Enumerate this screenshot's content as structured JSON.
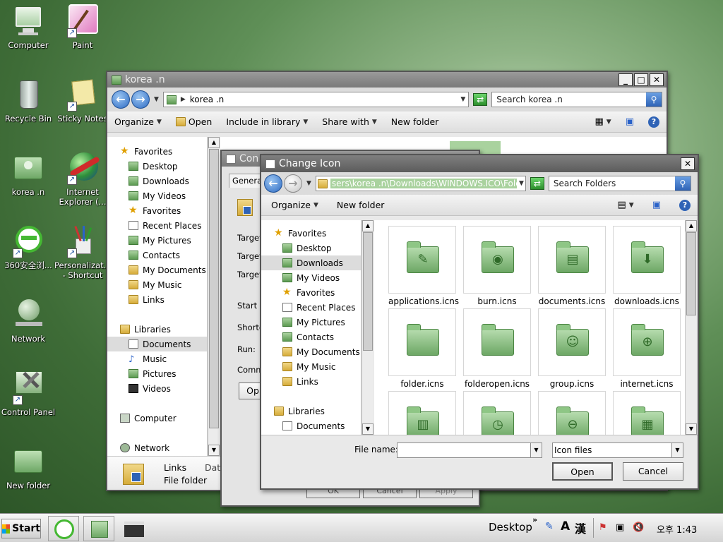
{
  "desktop": {
    "icons": [
      {
        "label": "Computer",
        "icon": "computer-icon"
      },
      {
        "label": "Paint",
        "icon": "paint-icon"
      },
      {
        "label": "Recycle Bin",
        "icon": "recycle-bin-icon"
      },
      {
        "label": "Sticky Notes",
        "icon": "sticky-notes-icon"
      },
      {
        "label": "korea .n",
        "icon": "user-folder-icon"
      },
      {
        "label": "Internet Explorer (...",
        "icon": "internet-explorer-icon"
      },
      {
        "label": "360安全浏...",
        "icon": "security-360-icon"
      },
      {
        "label": "Personalizat... - Shortcut",
        "icon": "personalization-icon"
      },
      {
        "label": "Network",
        "icon": "network-icon"
      },
      {
        "label": "Control Panel",
        "icon": "control-panel-icon"
      },
      {
        "label": "New folder",
        "icon": "folder-icon"
      }
    ]
  },
  "explorer": {
    "title": "korea .n",
    "address": "korea .n",
    "search_placeholder": "Search korea .n",
    "toolbar": {
      "organize": "Organize",
      "open": "Open",
      "include": "Include in library",
      "share": "Share with",
      "newfolder": "New folder"
    },
    "nav": {
      "favorites_head": "Favorites",
      "favorites": [
        "Desktop",
        "Downloads",
        "My Videos",
        "Favorites",
        "Recent Places",
        "My Pictures",
        "Contacts",
        "My Documents",
        "My Music",
        "Links"
      ],
      "libraries_head": "Libraries",
      "libraries": [
        "Documents",
        "Music",
        "Pictures",
        "Videos"
      ],
      "computer": "Computer",
      "network": "Network"
    },
    "details": {
      "name": "Links",
      "type": "File folder",
      "date_label": "Date"
    }
  },
  "properties": {
    "title": "Con",
    "tab": "General",
    "labels": [
      "Target",
      "Target",
      "Target",
      "Start in",
      "Shortc",
      "Run:",
      "Comme"
    ],
    "open_btn": "Op",
    "ok": "OK",
    "cancel": "Cancel",
    "apply": "Apply"
  },
  "change_icon": {
    "title": "Change Icon",
    "address": "sers\\korea .n\\Downloads\\WINDOWS.ICO\\Folders",
    "search_placeholder": "Search Folders",
    "toolbar": {
      "organize": "Organize",
      "newfolder": "New folder"
    },
    "nav": {
      "favorites_head": "Favorites",
      "favorites": [
        "Desktop",
        "Downloads",
        "My Videos",
        "Favorites",
        "Recent Places",
        "My Pictures",
        "Contacts",
        "My Documents",
        "My Music",
        "Links"
      ],
      "libraries_head": "Libraries",
      "libraries": [
        "Documents"
      ]
    },
    "files": [
      {
        "name": "applications.icns",
        "glyph": "✎"
      },
      {
        "name": "burn.icns",
        "glyph": "◉"
      },
      {
        "name": "documents.icns",
        "glyph": "▤"
      },
      {
        "name": "downloads.icns",
        "glyph": "⬇"
      },
      {
        "name": "folder.icns",
        "glyph": ""
      },
      {
        "name": "folderopen.icns",
        "glyph": ""
      },
      {
        "name": "group.icns",
        "glyph": "☺"
      },
      {
        "name": "internet.icns",
        "glyph": "⊕"
      },
      {
        "name": "",
        "glyph": "▥"
      },
      {
        "name": "",
        "glyph": "◷"
      },
      {
        "name": "",
        "glyph": "⊖"
      },
      {
        "name": "",
        "glyph": "▦"
      }
    ],
    "filename_label": "File name:",
    "filename_value": "",
    "filetype": "Icon files",
    "open": "Open",
    "cancel": "Cancel"
  },
  "taskbar": {
    "start": "Start",
    "desktop_label": "Desktop",
    "ime_a": "A",
    "ime_han": "漢",
    "clock": "오후 1:43"
  }
}
